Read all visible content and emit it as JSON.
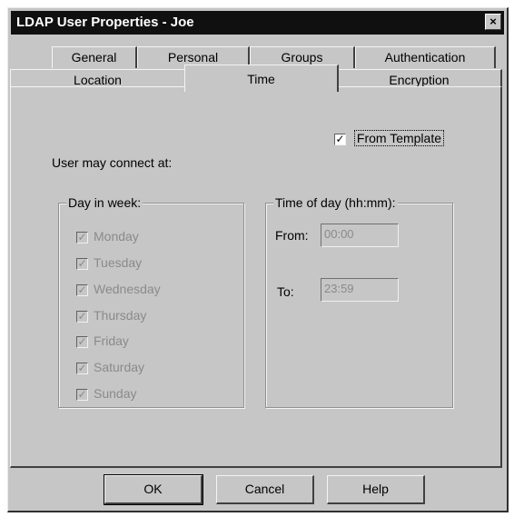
{
  "window": {
    "title": "LDAP User Properties - Joe",
    "close_glyph": "×"
  },
  "tabs_row1": [
    {
      "label": "General"
    },
    {
      "label": "Personal"
    },
    {
      "label": "Groups"
    },
    {
      "label": "Authentication"
    }
  ],
  "tabs_row2": [
    {
      "label": "Location"
    },
    {
      "label": "Time",
      "active": true
    },
    {
      "label": "Encryption"
    }
  ],
  "time_tab": {
    "from_template": {
      "label": "From Template",
      "checked": true
    },
    "intro": "User may connect at:",
    "day_group": {
      "legend": "Day in week:",
      "days": [
        {
          "label": "Monday",
          "checked": true
        },
        {
          "label": "Tuesday",
          "checked": true
        },
        {
          "label": "Wednesday",
          "checked": true
        },
        {
          "label": "Thursday",
          "checked": true
        },
        {
          "label": "Friday",
          "checked": true
        },
        {
          "label": "Saturday",
          "checked": true
        },
        {
          "label": "Sunday",
          "checked": true
        }
      ]
    },
    "time_group": {
      "legend": "Time of day (hh:mm):",
      "from_label": "From:",
      "from_value": "00:00",
      "to_label": "To:",
      "to_value": "23:59"
    }
  },
  "buttons": {
    "ok": "OK",
    "cancel": "Cancel",
    "help": "Help"
  },
  "check_glyph": "✓"
}
